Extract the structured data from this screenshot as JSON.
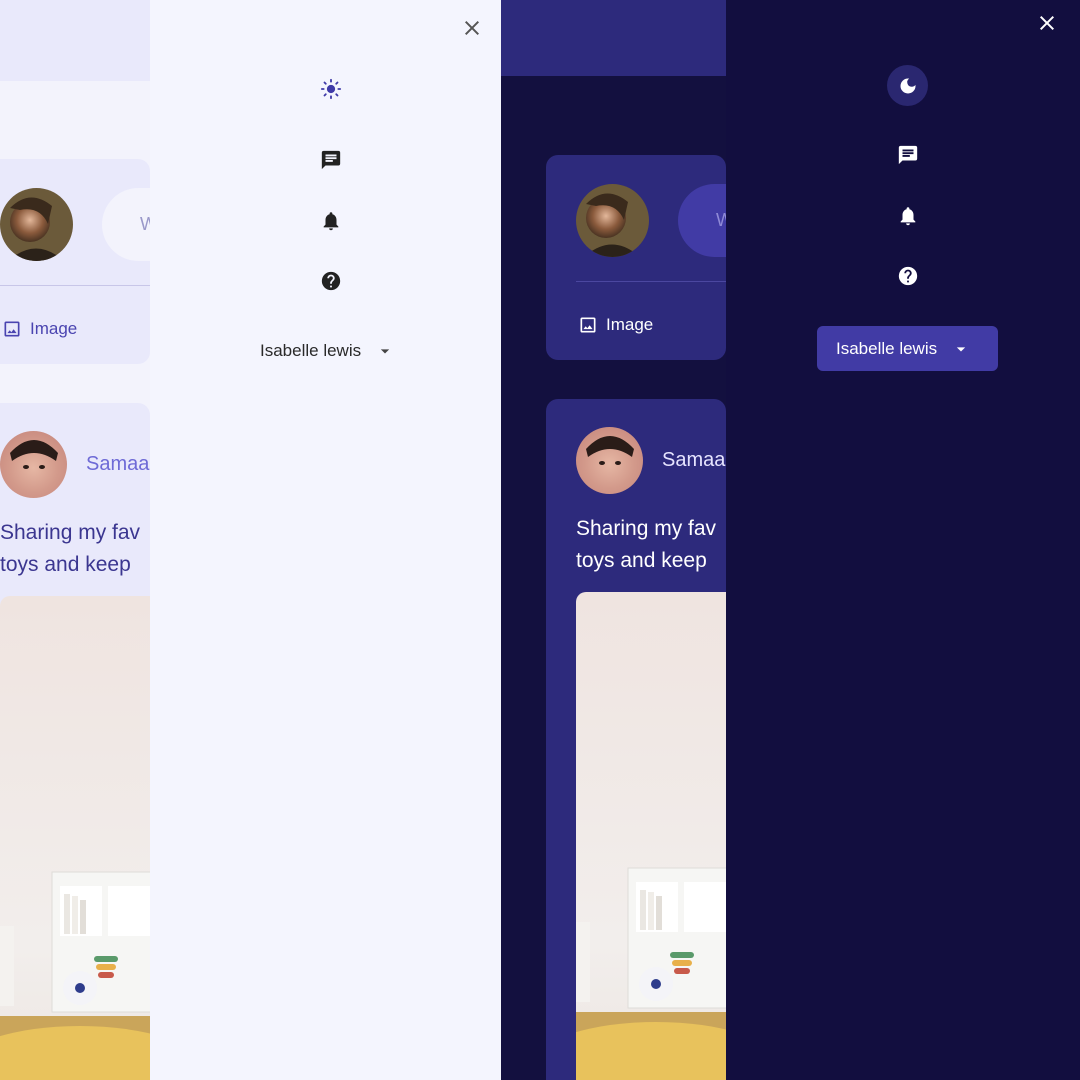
{
  "colors": {
    "light_bg": "#f3f3fc",
    "light_drawer": "#f4f5fe",
    "light_card": "#e9e9fb",
    "light_accent": "#4a44b0",
    "dark_bg": "#13103f",
    "dark_drawer": "#120e3f",
    "dark_card": "#2d2a7c",
    "dark_accent": "#413ba5"
  },
  "light": {
    "composer": {
      "input_placeholder": "W",
      "image_label": "Image"
    },
    "post": {
      "author": "Samaa",
      "text_line1": "Sharing my fav",
      "text_line2": "toys and keep"
    },
    "drawer": {
      "theme_icon": "sun-icon",
      "messages_icon": "message-icon",
      "notifications_icon": "bell-icon",
      "help_icon": "help-icon",
      "user_name": "Isabelle lewis"
    }
  },
  "dark": {
    "composer": {
      "input_placeholder": "W",
      "image_label": "Image"
    },
    "post": {
      "author": "Samaa",
      "text_line1": "Sharing my fav",
      "text_line2": "toys and keep"
    },
    "drawer": {
      "theme_icon": "moon-icon",
      "messages_icon": "message-icon",
      "notifications_icon": "bell-icon",
      "help_icon": "help-icon",
      "user_name": "Isabelle lewis"
    }
  }
}
